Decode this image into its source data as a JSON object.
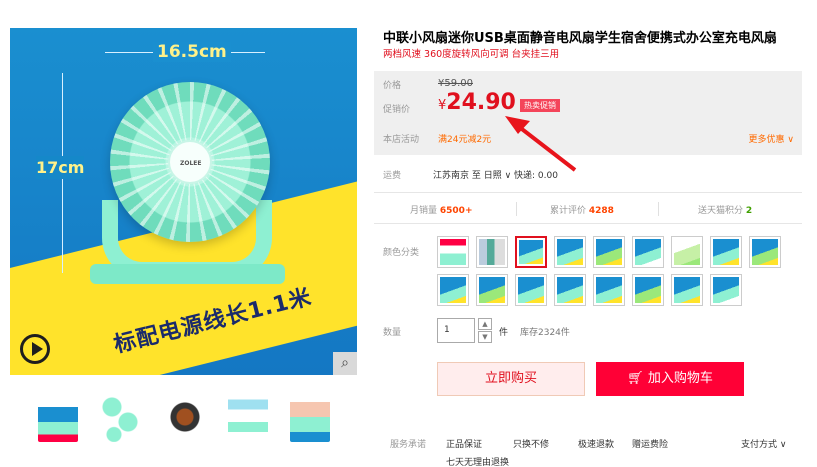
{
  "product": {
    "title": "中联小风扇迷你USB桌面静音电风扇学生宿舍便携式办公室充电风扇",
    "subtitle": "两档风速 360度旋转风向可调 台夹挂三用"
  },
  "gallery": {
    "dim_width": "16.5cm",
    "dim_height": "17cm",
    "brand": "ZOLEE",
    "banner_text": "标配电源线长1.1米",
    "play_icon": "play-circle-icon",
    "zoom_icon": "magnifier-icon",
    "thumbnails": [
      "thumb-1",
      "thumb-2",
      "thumb-3",
      "thumb-4",
      "thumb-5"
    ]
  },
  "price": {
    "orig_label": "价格",
    "orig_price": "¥59.00",
    "promo_label": "促销价",
    "currency": "¥",
    "promo_price": "24.90",
    "hot_tag": "热卖促销",
    "activity_label": "本店活动",
    "activity_text": "满24元减2元",
    "more_offers": "更多优惠"
  },
  "shipping": {
    "label": "运费",
    "value": "江苏南京 至 日照 ∨ 快递: 0.00"
  },
  "stats": {
    "monthly_sales_label": "月销量",
    "monthly_sales_value": "6500+",
    "reviews_label": "累计评价",
    "reviews_value": "4288",
    "points_label": "送天猫积分",
    "points_value": "2"
  },
  "sku": {
    "label": "颜色分类",
    "selected_index": 2,
    "count": 17
  },
  "quantity": {
    "label": "数量",
    "value": "1",
    "unit": "件",
    "stock": "库存2324件"
  },
  "actions": {
    "buy_now": "立即购买",
    "add_cart": "加入购物车",
    "cart_icon": "cart-icon"
  },
  "service": {
    "label": "服务承诺",
    "items": [
      "正品保证",
      "只换不修",
      "极速退款",
      "赠运费险"
    ],
    "pay_method": "支付方式 ∨",
    "extra": "七天无理由退换"
  },
  "colors": {
    "accent": "#e0101e",
    "cart_red": "#ff0036",
    "orange": "#ff6a00",
    "banner_yellow": "#ffe32b",
    "image_blue": "#1a8fd0",
    "fan_mint": "#8ef0d2"
  }
}
